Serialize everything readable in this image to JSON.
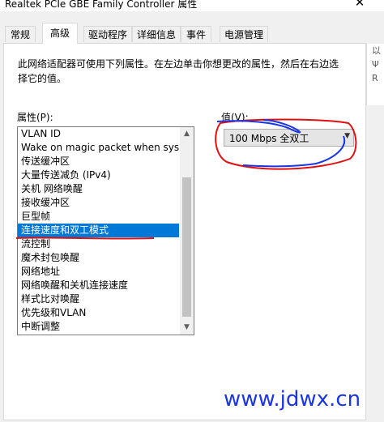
{
  "window": {
    "title": "Realtek PCIe GBE Family Controller 属性",
    "close_glyph": "✕"
  },
  "tabs": [
    {
      "label": "常规",
      "active": false
    },
    {
      "label": "高级",
      "active": true
    },
    {
      "label": "驱动程序",
      "active": false
    },
    {
      "label": "详细信息",
      "active": false
    },
    {
      "label": "事件",
      "active": false
    },
    {
      "label": "电源管理",
      "active": false
    }
  ],
  "panel": {
    "description": "此网络适配器可使用下列属性。在左边单击你想更改的属性，然后在右边选择它的值。",
    "property_label": "属性(P):",
    "value_label": "值(V):",
    "properties": [
      "VLAN ID",
      "Wake on magic packet when syst",
      "传送缓冲区",
      "大量传送减负 (IPv4)",
      "关机 网络唤醒",
      "接收缓冲区",
      "巨型帧",
      "连接速度和双工模式",
      "流控制",
      "魔术封包唤醒",
      "网络地址",
      "网络唤醒和关机连接速度",
      "样式比对唤醒",
      "优先级和VLAN",
      "中断调整"
    ],
    "selected_index": 7,
    "value_selected": "100 Mbps 全双工"
  },
  "right_peek": [
    "以",
    "Ψ",
    "R"
  ],
  "watermark": "www.jdwx.cn",
  "colors": {
    "selection": "#0078d7",
    "annotation_red": "#e01010",
    "annotation_blue": "#1a35e6"
  }
}
